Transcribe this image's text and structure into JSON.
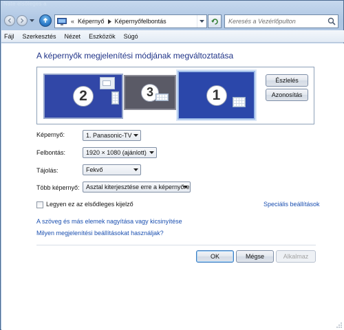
{
  "window": {
    "ghost_title": "Nate elsőleges a"
  },
  "address_bar": {
    "chevrons": "«",
    "segments": [
      "Képernyő",
      "Képernyőfelbontás"
    ]
  },
  "search": {
    "placeholder": "Keresés a Vezérlőpulton"
  },
  "menu": {
    "items": [
      "Fájl",
      "Szerkesztés",
      "Nézet",
      "Eszközök",
      "Súgó"
    ]
  },
  "main": {
    "heading": "A képernyők megjelenítési módjának megváltoztatása",
    "monitors": [
      {
        "number": "2"
      },
      {
        "number": "3"
      },
      {
        "number": "1"
      }
    ],
    "detect_button": "Észlelés",
    "identify_button": "Azonosítás",
    "fields": {
      "display_label": "Képernyő:",
      "display_value": "1. Panasonic-TV",
      "resolution_label": "Felbontás:",
      "resolution_value": "1920 × 1080 (ajánlott)",
      "orientation_label": "Tájolás:",
      "orientation_value": "Fekvő",
      "multiple_label": "Több képernyő:",
      "multiple_value": "Asztal kiterjesztése erre a képernyőre"
    },
    "primary_checkbox_label": "Legyen ez az elsődleges kijelző",
    "advanced_link": "Speciális beállítások",
    "links": {
      "resize_text": "A szöveg és más elemek nagyítása vagy kicsinyítése",
      "which_settings": "Milyen megjelenítési beállításokat használjak?"
    },
    "buttons": {
      "ok": "OK",
      "cancel": "Mégse",
      "apply": "Alkalmaz"
    }
  },
  "colors": {
    "heading": "#1e3287",
    "link": "#1a4fb0",
    "monitor_active": "#2b47aa"
  }
}
